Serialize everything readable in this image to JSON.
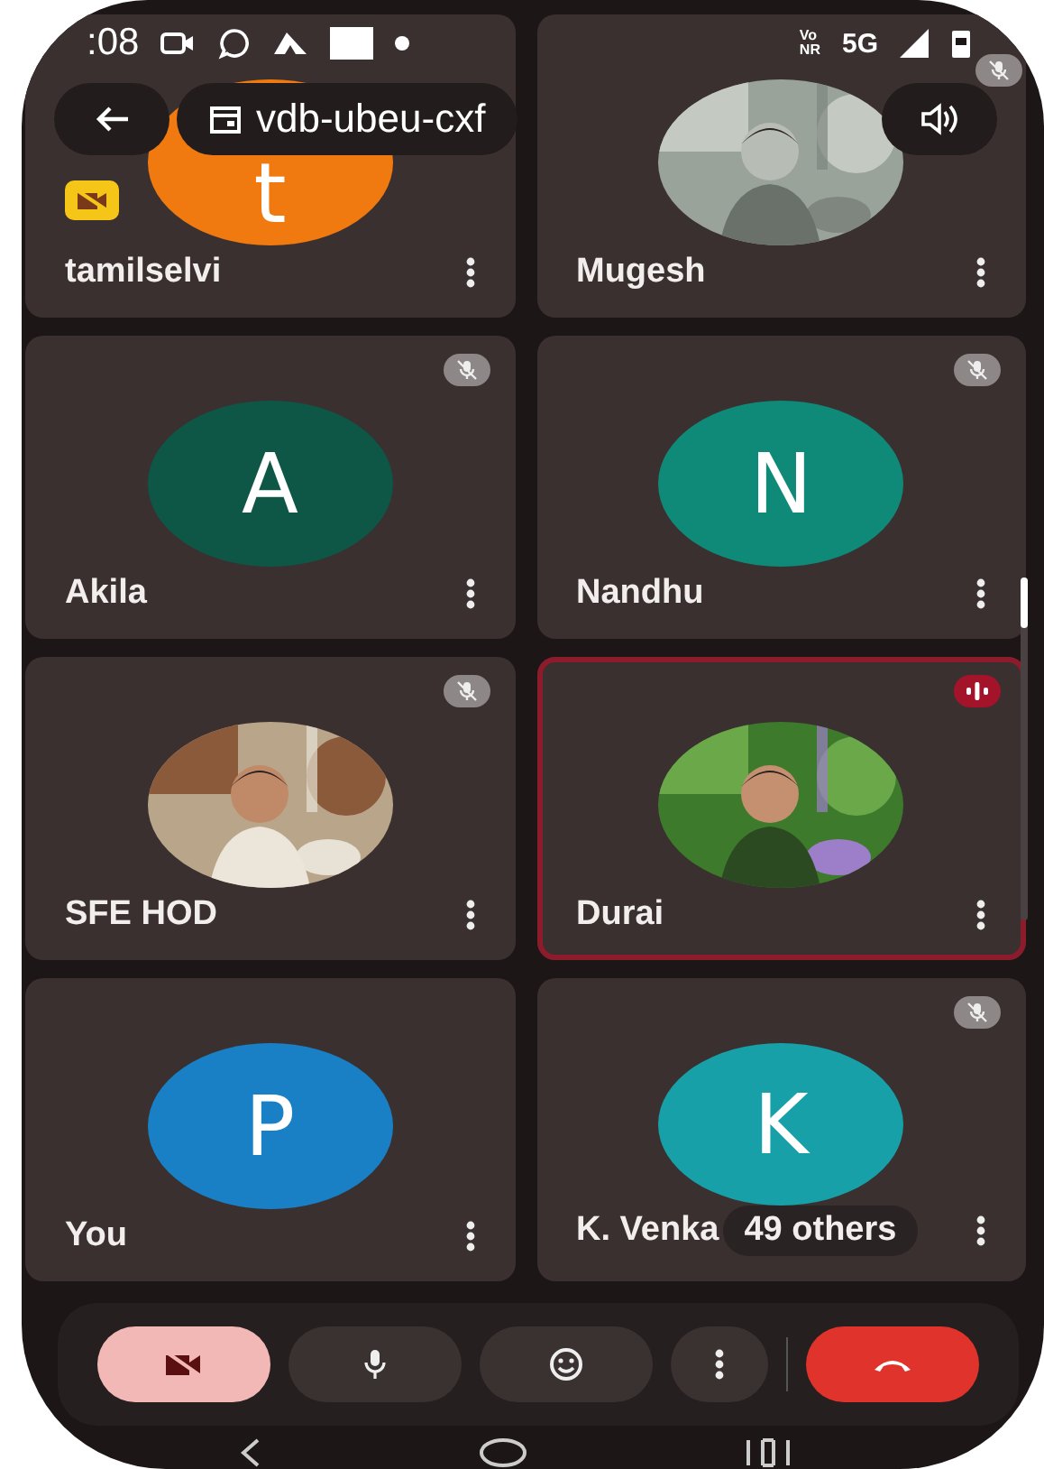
{
  "status_bar": {
    "time": ":08",
    "network_top": "Vo",
    "network_bottom": "NR",
    "network_type": "5G"
  },
  "meeting": {
    "code": "vdb-ubeu-cxf"
  },
  "tiles": [
    {
      "name": "tamilselvi",
      "kind": "letter",
      "letter": "t",
      "color": "#f07a10",
      "muted": false,
      "speaking": false,
      "camera_off_badge": true
    },
    {
      "name": "Mugesh",
      "muted": true,
      "speaking": false,
      "camera_off_badge": false
    },
    {
      "name": "Akila",
      "kind": "letter",
      "letter": "A",
      "color": "#0e5747",
      "muted": true,
      "speaking": false,
      "camera_off_badge": false
    },
    {
      "name": "Nandhu",
      "kind": "letter",
      "letter": "N",
      "color": "#0f8a78",
      "muted": true,
      "speaking": false,
      "camera_off_badge": false
    },
    {
      "name": "SFE HOD",
      "muted": true,
      "speaking": false,
      "camera_off_badge": false
    },
    {
      "name": "Durai",
      "muted": false,
      "speaking": true,
      "camera_off_badge": false
    },
    {
      "name": "You",
      "kind": "letter",
      "letter": "P",
      "color": "#1a80c6",
      "muted": false,
      "speaking": false,
      "camera_off_badge": false
    },
    {
      "name": "K. Venka",
      "kind": "letter",
      "letter": "K",
      "color": "#17a0a8",
      "muted": true,
      "speaking": false,
      "camera_off_badge": false,
      "others": "49 others"
    }
  ],
  "controls": [
    {
      "kind": "camera",
      "active": true
    },
    {
      "kind": "mic",
      "active": false
    },
    {
      "kind": "reactions",
      "active": false
    },
    {
      "kind": "more",
      "active": false
    },
    {
      "kind": "hangup"
    }
  ]
}
